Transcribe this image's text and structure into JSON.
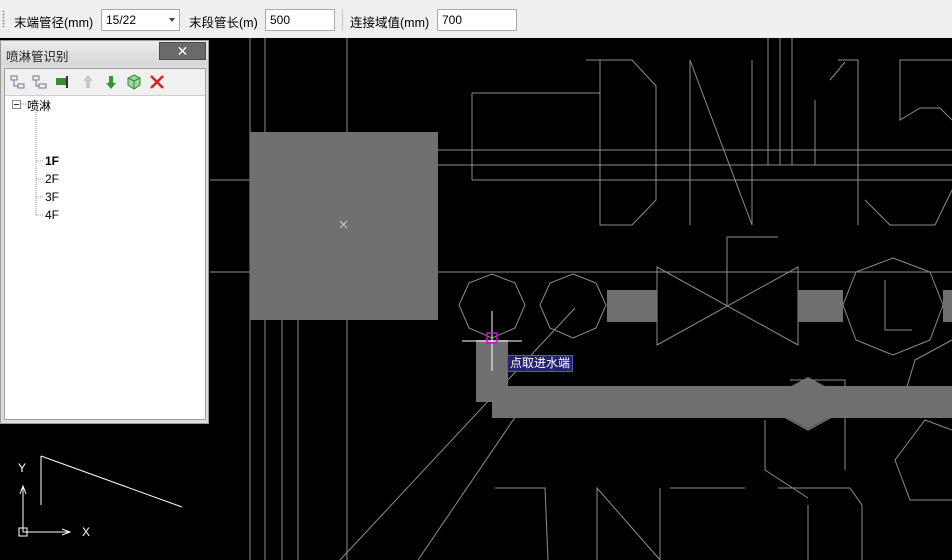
{
  "toolbar": {
    "end_pipe_diameter_label": "末端管径(mm)",
    "end_pipe_diameter_value": "15/22",
    "end_segment_length_label": "末段管长(m)",
    "end_segment_length_value": "500",
    "connect_domain_label": "连接域值(mm)",
    "connect_domain_value": "700"
  },
  "panel": {
    "title": "喷淋管识别",
    "close_symbol": "✕",
    "tools": [
      "add-child-icon",
      "add-sibling-icon",
      "rename-icon",
      "move-up-icon",
      "move-down-icon",
      "box-icon",
      "delete-icon"
    ],
    "tree_root": "喷淋",
    "floors": [
      "1F",
      "2F",
      "3F",
      "4F"
    ],
    "selected_floor": "1F"
  },
  "canvas": {
    "tooltip": "点取进水端",
    "axis_y": "Y",
    "axis_x": "X",
    "colors": {
      "background": "#000000",
      "lines": "#8c8c8c",
      "fill": "#707070",
      "cursor_box": "#e000e0",
      "tooltip_bg": "#23236e"
    }
  }
}
